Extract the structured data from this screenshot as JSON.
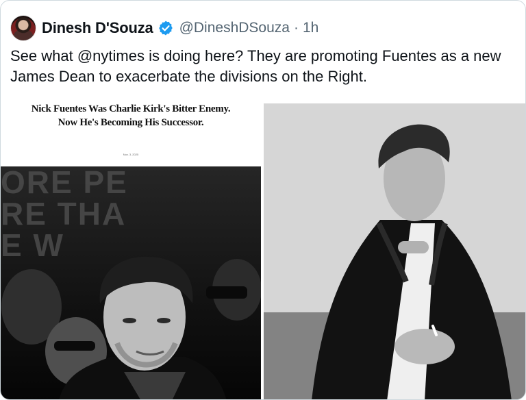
{
  "author": {
    "name": "Dinesh D'Souza",
    "handle": "@DineshDSouza",
    "separator": "·",
    "time": "1h"
  },
  "tweet": {
    "text": "See what @nytimes is doing here? They are promoting Fuentes as a new James Dean to exacerbate the divisions on the Right."
  },
  "media": {
    "left": {
      "headline": "Nick Fuentes Was Charlie Kirk's Bitter Enemy. Now He's Becoming His Successor.",
      "date": "Nov. 3, 2025",
      "sign_lines": [
        "ORE PE",
        "RE THA",
        "E W"
      ]
    }
  },
  "colors": {
    "verified": "#1d9bf0",
    "muted": "#536471",
    "text": "#0f1419",
    "border": "#cfd9de"
  },
  "icons": {
    "verified": "verified-badge-icon"
  }
}
